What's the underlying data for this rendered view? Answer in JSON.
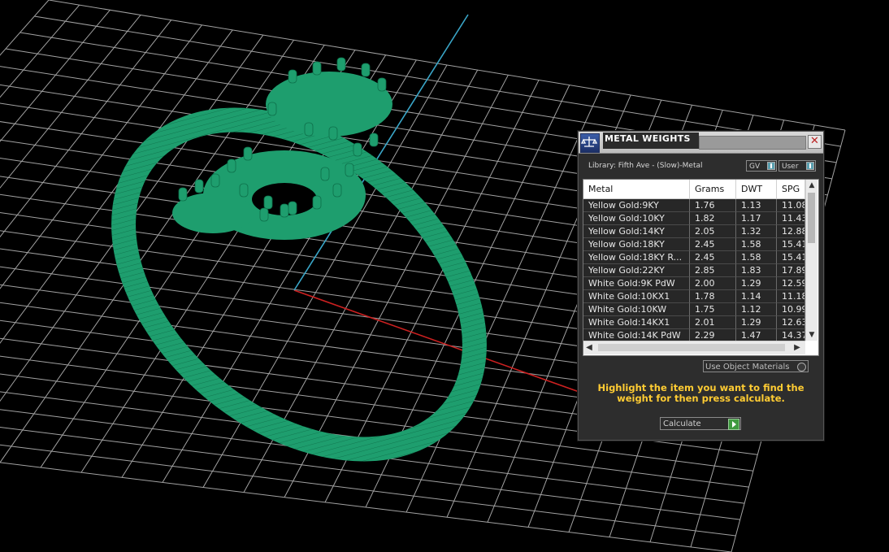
{
  "colors": {
    "ring": "#1e9e6e",
    "grid": "#bfbfbf",
    "axis_x": "#cc2020",
    "axis_y": "#3aa6c8",
    "instruction_text": "#ffcc33"
  },
  "dialog": {
    "title": "METAL WEIGHTS",
    "close_symbol": "✕",
    "library_label": "Library: Fifth Ave - (Slow)-Metal",
    "mode_gv": "GV",
    "mode_user": "User",
    "table": {
      "columns": [
        "Metal",
        "Grams",
        "DWT",
        "SPG"
      ],
      "rows": [
        [
          "Yellow Gold:9KY",
          "1.76",
          "1.13",
          "11.08"
        ],
        [
          "Yellow Gold:10KY",
          "1.82",
          "1.17",
          "11.43"
        ],
        [
          "Yellow Gold:14KY",
          "2.05",
          "1.32",
          "12.88"
        ],
        [
          "Yellow Gold:18KY",
          "2.45",
          "1.58",
          "15.41"
        ],
        [
          "Yellow Gold:18KY R...",
          "2.45",
          "1.58",
          "15.41"
        ],
        [
          "Yellow Gold:22KY",
          "2.85",
          "1.83",
          "17.89"
        ],
        [
          "White Gold:9K PdW",
          "2.00",
          "1.29",
          "12.59"
        ],
        [
          "White Gold:10KX1",
          "1.78",
          "1.14",
          "11.18"
        ],
        [
          "White Gold:10KW",
          "1.75",
          "1.12",
          "10.99"
        ],
        [
          "White Gold:14KX1",
          "2.01",
          "1.29",
          "12.63"
        ],
        [
          "White Gold:14K PdW",
          "2.29",
          "1.47",
          "14.37"
        ]
      ]
    },
    "use_object_materials": "Use Object Materials",
    "instruction": "Highlight the item you want to find the weight for then press calculate.",
    "calculate_label": "Calculate"
  }
}
